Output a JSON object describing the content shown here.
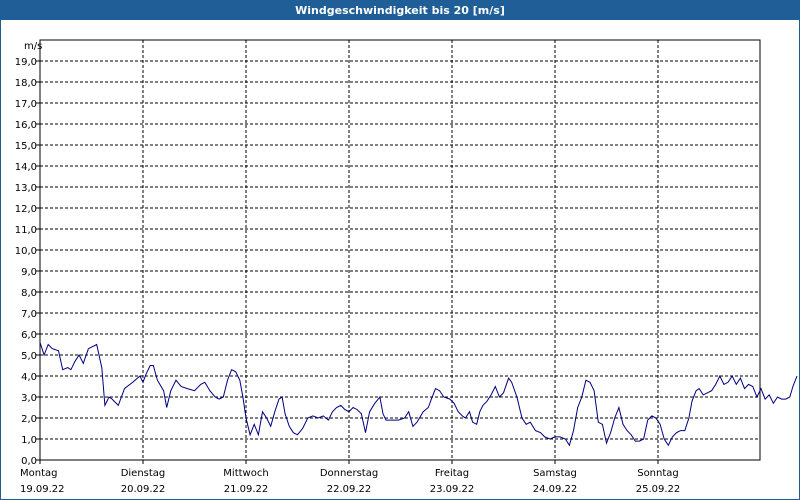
{
  "window": {
    "title": "Windgeschwindigkeit bis 20 [m/s]"
  },
  "chart_data": {
    "type": "line",
    "title": "Windgeschwindigkeit bis 20 [m/s]",
    "ylabel": "m/s",
    "ylim": [
      0,
      20
    ],
    "y_ticks": [
      "0,0",
      "1,0",
      "2,0",
      "3,0",
      "4,0",
      "5,0",
      "6,0",
      "7,0",
      "8,0",
      "9,0",
      "10,0",
      "11,0",
      "12,0",
      "13,0",
      "14,0",
      "15,0",
      "16,0",
      "17,0",
      "18,0",
      "19,0"
    ],
    "x_unit": "days",
    "xlim": [
      0,
      7
    ],
    "days": [
      {
        "weekday": "Montag",
        "date": "19.09.22"
      },
      {
        "weekday": "Dienstag",
        "date": "20.09.22"
      },
      {
        "weekday": "Mittwoch",
        "date": "21.09.22"
      },
      {
        "weekday": "Donnerstag",
        "date": "22.09.22"
      },
      {
        "weekday": "Freitag",
        "date": "23.09.22"
      },
      {
        "weekday": "Samstag",
        "date": "24.09.22"
      },
      {
        "weekday": "Sonntag",
        "date": "25.09.22"
      }
    ],
    "grid": true,
    "colors": {
      "line": "#000080",
      "grid": "#000000",
      "axis": "#000000",
      "title_bar": "#1f5e97"
    },
    "series": [
      {
        "values": [
          [
            0.0,
            5.6
          ],
          [
            0.04,
            5.0
          ],
          [
            0.08,
            5.5
          ],
          [
            0.12,
            5.3
          ],
          [
            0.18,
            5.2
          ],
          [
            0.22,
            4.3
          ],
          [
            0.27,
            4.4
          ],
          [
            0.3,
            4.3
          ],
          [
            0.34,
            4.7
          ],
          [
            0.38,
            5.0
          ],
          [
            0.42,
            4.6
          ],
          [
            0.47,
            5.3
          ],
          [
            0.55,
            5.5
          ],
          [
            0.6,
            4.4
          ],
          [
            0.63,
            2.6
          ],
          [
            0.67,
            3.0
          ],
          [
            0.7,
            2.9
          ],
          [
            0.76,
            2.6
          ],
          [
            0.82,
            3.4
          ],
          [
            0.9,
            3.7
          ],
          [
            0.97,
            4.0
          ],
          [
            1.0,
            3.7
          ],
          [
            1.03,
            4.1
          ],
          [
            1.07,
            4.5
          ],
          [
            1.1,
            4.5
          ],
          [
            1.14,
            3.8
          ],
          [
            1.2,
            3.3
          ],
          [
            1.23,
            2.5
          ],
          [
            1.27,
            3.3
          ],
          [
            1.32,
            3.8
          ],
          [
            1.37,
            3.5
          ],
          [
            1.43,
            3.4
          ],
          [
            1.5,
            3.3
          ],
          [
            1.56,
            3.6
          ],
          [
            1.6,
            3.7
          ],
          [
            1.65,
            3.3
          ],
          [
            1.7,
            3.0
          ],
          [
            1.74,
            2.9
          ],
          [
            1.78,
            3.0
          ],
          [
            1.82,
            3.8
          ],
          [
            1.86,
            4.3
          ],
          [
            1.9,
            4.2
          ],
          [
            1.94,
            3.8
          ],
          [
            1.97,
            3.0
          ],
          [
            2.0,
            2.0
          ],
          [
            2.04,
            1.2
          ],
          [
            2.08,
            1.7
          ],
          [
            2.12,
            1.2
          ],
          [
            2.16,
            2.3
          ],
          [
            2.2,
            2.0
          ],
          [
            2.24,
            1.6
          ],
          [
            2.28,
            2.3
          ],
          [
            2.32,
            2.9
          ],
          [
            2.35,
            3.0
          ],
          [
            2.38,
            2.2
          ],
          [
            2.42,
            1.6
          ],
          [
            2.46,
            1.3
          ],
          [
            2.5,
            1.2
          ],
          [
            2.55,
            1.5
          ],
          [
            2.6,
            2.0
          ],
          [
            2.65,
            2.1
          ],
          [
            2.7,
            2.0
          ],
          [
            2.75,
            2.1
          ],
          [
            2.8,
            1.9
          ],
          [
            2.84,
            2.3
          ],
          [
            2.88,
            2.5
          ],
          [
            2.92,
            2.6
          ],
          [
            2.96,
            2.4
          ],
          [
            3.0,
            2.3
          ],
          [
            3.04,
            2.5
          ],
          [
            3.08,
            2.4
          ],
          [
            3.12,
            2.2
          ],
          [
            3.16,
            1.3
          ],
          [
            3.2,
            2.3
          ],
          [
            3.25,
            2.7
          ],
          [
            3.3,
            3.0
          ],
          [
            3.33,
            2.2
          ],
          [
            3.36,
            1.9
          ],
          [
            3.42,
            1.9
          ],
          [
            3.48,
            1.9
          ],
          [
            3.54,
            2.0
          ],
          [
            3.58,
            2.3
          ],
          [
            3.62,
            1.6
          ],
          [
            3.66,
            1.8
          ],
          [
            3.72,
            2.3
          ],
          [
            3.77,
            2.5
          ],
          [
            3.8,
            2.9
          ],
          [
            3.84,
            3.4
          ],
          [
            3.88,
            3.3
          ],
          [
            3.92,
            3.0
          ],
          [
            3.98,
            2.9
          ],
          [
            4.02,
            2.7
          ],
          [
            4.06,
            2.3
          ],
          [
            4.1,
            2.1
          ],
          [
            4.13,
            2.0
          ],
          [
            4.17,
            2.3
          ],
          [
            4.2,
            1.8
          ],
          [
            4.24,
            1.7
          ],
          [
            4.27,
            2.3
          ],
          [
            4.3,
            2.6
          ],
          [
            4.34,
            2.8
          ],
          [
            4.38,
            3.1
          ],
          [
            4.42,
            3.5
          ],
          [
            4.46,
            3.0
          ],
          [
            4.5,
            3.2
          ],
          [
            4.55,
            3.9
          ],
          [
            4.58,
            3.7
          ],
          [
            4.63,
            3.0
          ],
          [
            4.68,
            2.0
          ],
          [
            4.72,
            1.7
          ],
          [
            4.76,
            1.8
          ],
          [
            4.81,
            1.4
          ],
          [
            4.86,
            1.3
          ],
          [
            4.9,
            1.1
          ],
          [
            4.95,
            1.0
          ],
          [
            5.0,
            1.1
          ],
          [
            5.05,
            1.1
          ],
          [
            5.1,
            1.0
          ],
          [
            5.14,
            0.7
          ],
          [
            5.18,
            1.4
          ],
          [
            5.22,
            2.5
          ],
          [
            5.26,
            3.0
          ],
          [
            5.3,
            3.8
          ],
          [
            5.34,
            3.7
          ],
          [
            5.38,
            3.3
          ],
          [
            5.42,
            1.8
          ],
          [
            5.46,
            1.7
          ],
          [
            5.5,
            0.8
          ],
          [
            5.54,
            1.3
          ],
          [
            5.58,
            2.0
          ],
          [
            5.62,
            2.5
          ],
          [
            5.66,
            1.7
          ],
          [
            5.7,
            1.4
          ],
          [
            5.74,
            1.2
          ],
          [
            5.78,
            0.9
          ],
          [
            5.82,
            0.9
          ],
          [
            5.86,
            1.0
          ],
          [
            5.9,
            1.9
          ],
          [
            5.94,
            2.1
          ],
          [
            5.98,
            2.0
          ],
          [
            6.02,
            1.7
          ],
          [
            6.06,
            1.0
          ],
          [
            6.1,
            0.7
          ],
          [
            6.14,
            1.1
          ],
          [
            6.18,
            1.3
          ],
          [
            6.22,
            1.4
          ],
          [
            6.26,
            1.4
          ],
          [
            6.3,
            2.0
          ],
          [
            6.33,
            2.8
          ],
          [
            6.37,
            3.3
          ],
          [
            6.4,
            3.4
          ],
          [
            6.44,
            3.1
          ],
          [
            6.48,
            3.2
          ],
          [
            6.52,
            3.3
          ],
          [
            6.56,
            3.6
          ],
          [
            6.6,
            4.0
          ],
          [
            6.64,
            3.6
          ],
          [
            6.68,
            3.7
          ],
          [
            6.72,
            4.0
          ],
          [
            6.76,
            3.6
          ],
          [
            6.8,
            3.9
          ],
          [
            6.84,
            3.4
          ],
          [
            6.88,
            3.6
          ],
          [
            6.92,
            3.5
          ],
          [
            6.96,
            3.0
          ],
          [
            7.0,
            3.4
          ],
          [
            7.04,
            2.9
          ],
          [
            7.08,
            3.1
          ],
          [
            7.12,
            2.7
          ],
          [
            7.16,
            3.0
          ],
          [
            7.2,
            2.9
          ],
          [
            7.24,
            2.9
          ],
          [
            7.28,
            3.0
          ],
          [
            7.31,
            3.5
          ],
          [
            7.35,
            4.0
          ]
        ]
      }
    ]
  }
}
